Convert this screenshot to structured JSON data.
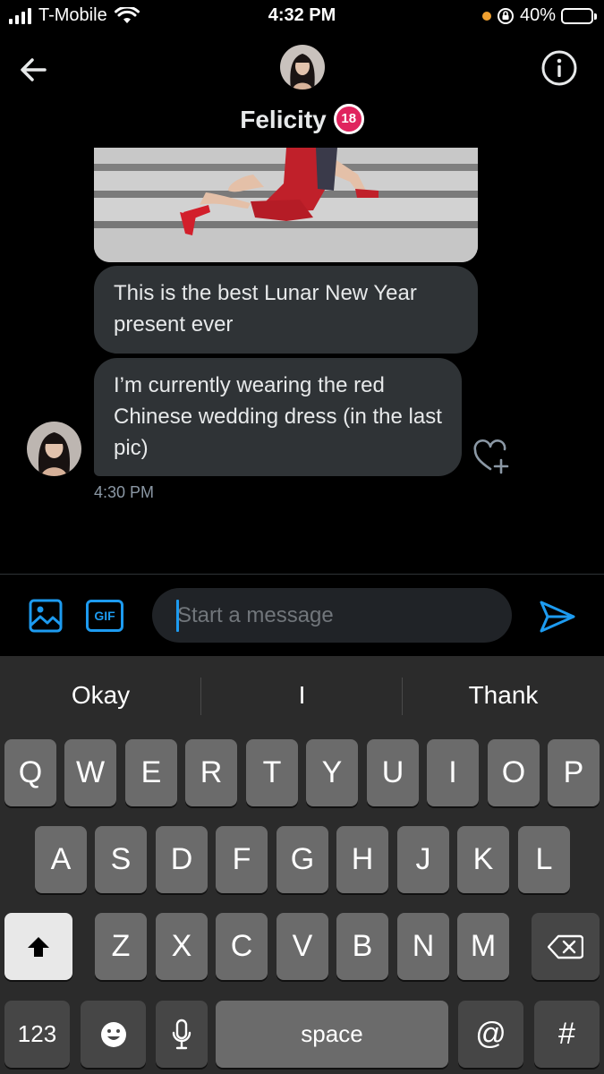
{
  "status_bar": {
    "carrier": "T-Mobile",
    "time": "4:32 PM",
    "battery": "40%",
    "battery_level": 0.4
  },
  "header": {
    "name": "Felicity",
    "badge": "18",
    "back_icon": "arrow-left-icon",
    "info_icon": "info-icon"
  },
  "messages": [
    {
      "type": "image",
      "description_icon": "photo-attachment"
    },
    {
      "type": "text",
      "text": "This is the best Lunar New Year present ever"
    },
    {
      "type": "text",
      "text": "I’m currently wearing the red Chinese wedding dress (in the last pic)"
    }
  ],
  "last_message_time": "4:30 PM",
  "composer": {
    "gif_label": "GIF",
    "placeholder": "Start a message"
  },
  "keyboard": {
    "suggestions": [
      "Okay",
      "I",
      "Thank"
    ],
    "row1": [
      "Q",
      "W",
      "E",
      "R",
      "T",
      "Y",
      "U",
      "I",
      "O",
      "P"
    ],
    "row2": [
      "A",
      "S",
      "D",
      "F",
      "G",
      "H",
      "J",
      "K",
      "L"
    ],
    "row3": [
      "Z",
      "X",
      "C",
      "V",
      "B",
      "N",
      "M"
    ],
    "numbers_label": "123",
    "space_label": "space",
    "at_label": "@",
    "hash_label": "#"
  },
  "colors": {
    "accent": "#1d9bf0",
    "bubble": "#2f3336",
    "badge_red": "#e0245e"
  }
}
